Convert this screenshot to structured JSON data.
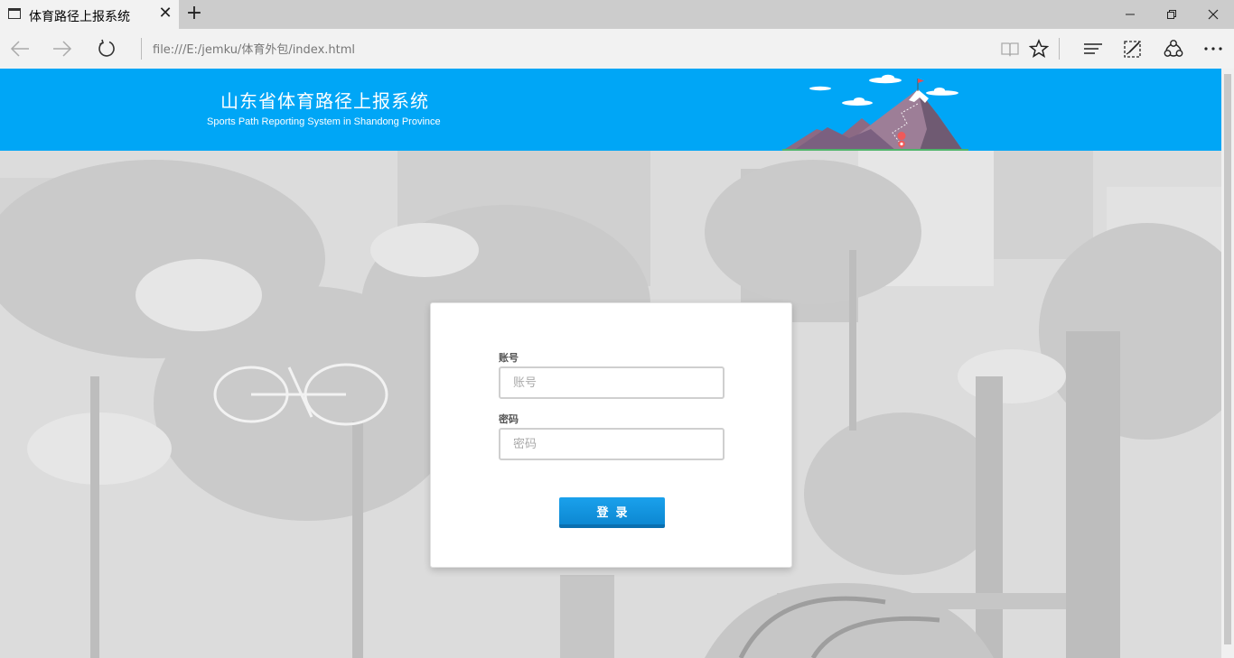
{
  "browser": {
    "tab_title": "体育路径上报系统",
    "tab_close": "✕",
    "new_tab": "+",
    "url": "file:///E:/jemku/体育外包/index.html",
    "icons": [
      "page-icon",
      "back-icon",
      "forward-icon",
      "refresh-icon",
      "reading-view-icon",
      "favorite-star-icon",
      "hub-icon",
      "web-note-icon",
      "share-icon",
      "more-icon",
      "minimize-icon",
      "restore-icon",
      "close-icon"
    ]
  },
  "header": {
    "title": "山东省体育路径上报系统",
    "subtitle": "Sports Path Reporting System in Shandong Province",
    "background_color": "#00a6f6"
  },
  "login": {
    "account_label": "账号",
    "account_placeholder": "账号",
    "account_value": "",
    "password_label": "密码",
    "password_placeholder": "密码",
    "password_value": "",
    "submit_label": "登录",
    "button_color": "#1a9be6"
  }
}
